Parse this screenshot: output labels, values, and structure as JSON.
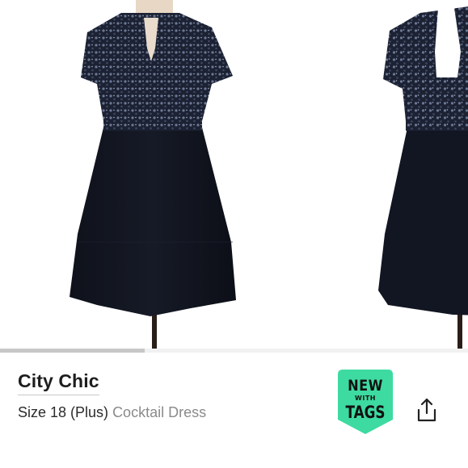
{
  "gallery": {
    "images": [
      "dress-front-photo",
      "dress-back-photo"
    ],
    "progress_fraction": 0.31
  },
  "product": {
    "brand": "City Chic",
    "size": "Size 18 (Plus)",
    "category": "Cocktail Dress"
  },
  "badge": {
    "line1": "NEW",
    "line2": "WITH",
    "line3": "TAGS",
    "color": "#3ddba1"
  },
  "actions": {
    "share_icon": "share-icon"
  }
}
